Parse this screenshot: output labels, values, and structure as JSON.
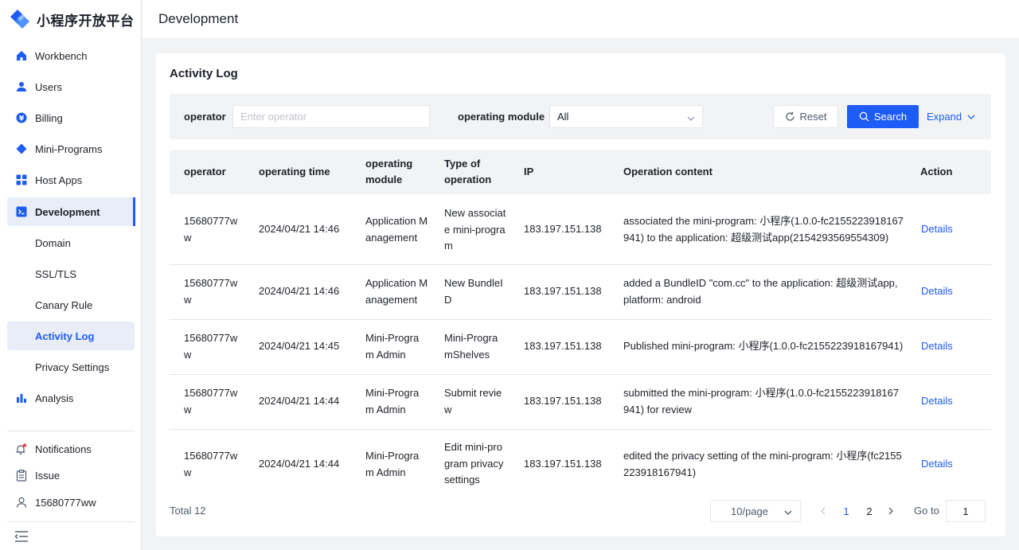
{
  "app": {
    "name": "小程序开放平台"
  },
  "sidebar": {
    "items": [
      {
        "label": "Workbench",
        "icon": "home-icon"
      },
      {
        "label": "Users",
        "icon": "user-icon"
      },
      {
        "label": "Billing",
        "icon": "billing-icon"
      },
      {
        "label": "Mini-Programs",
        "icon": "diamond-icon"
      },
      {
        "label": "Host Apps",
        "icon": "grid-icon"
      },
      {
        "label": "Development",
        "icon": "terminal-icon",
        "active": true
      }
    ],
    "sub_items": [
      {
        "label": "Domain"
      },
      {
        "label": "SSL/TLS"
      },
      {
        "label": "Canary Rule"
      },
      {
        "label": "Activity Log",
        "active": true
      },
      {
        "label": "Privacy Settings"
      }
    ],
    "analysis": {
      "label": "Analysis",
      "icon": "bar-chart-icon"
    },
    "bottom": [
      {
        "label": "Notifications",
        "icon": "bell-icon"
      },
      {
        "label": "Issue",
        "icon": "clipboard-icon"
      },
      {
        "label": "15680777ww",
        "icon": "person-icon"
      }
    ]
  },
  "header": {
    "title": "Development"
  },
  "card": {
    "title": "Activity Log"
  },
  "filter": {
    "operator_label": "operator",
    "operator_placeholder": "Enter operator",
    "operator_value": "",
    "module_label": "operating module",
    "module_value": "All",
    "reset_label": "Reset",
    "search_label": "Search",
    "expand_label": "Expand"
  },
  "table": {
    "columns": [
      "operator",
      "operating time",
      "operating module",
      "Type of operation",
      "IP",
      "Operation content",
      "Action"
    ],
    "rows": [
      {
        "operator": "15680777ww",
        "time": "2024/04/21 14:46",
        "module": "Application Management",
        "type": "New associate mini-program",
        "ip": "183.197.151.138",
        "content": "associated the mini-program: 小程序(1.0.0-fc2155223918167941) to the application: 超级测试app(2154293569554309)",
        "action": "Details"
      },
      {
        "operator": "15680777ww",
        "time": "2024/04/21 14:46",
        "module": "Application Management",
        "type": "New BundleID",
        "ip": "183.197.151.138",
        "content": "added a BundleID \"com.cc\" to the application: 超级测试app, platform: android",
        "action": "Details"
      },
      {
        "operator": "15680777ww",
        "time": "2024/04/21 14:45",
        "module": "Mini-Program Admin",
        "type": "Mini-ProgramShelves",
        "ip": "183.197.151.138",
        "content": "Published mini-program: 小程序(1.0.0-fc2155223918167941)",
        "action": "Details"
      },
      {
        "operator": "15680777ww",
        "time": "2024/04/21 14:44",
        "module": "Mini-Program Admin",
        "type": "Submit review",
        "ip": "183.197.151.138",
        "content": "submitted the mini-program: 小程序(1.0.0-fc2155223918167941) for review",
        "action": "Details"
      },
      {
        "operator": "15680777ww",
        "time": "2024/04/21 14:44",
        "module": "Mini-Program Admin",
        "type": "Edit mini-program privacy settings",
        "ip": "183.197.151.138",
        "content": "edited the privacy setting of the mini-program: 小程序(fc2155223918167941)",
        "action": "Details"
      }
    ]
  },
  "pagination": {
    "total": "Total 12",
    "page_size": "10/page",
    "pages": [
      "1",
      "2"
    ],
    "current": "1",
    "goto_label": "Go to",
    "goto_value": "1"
  },
  "colors": {
    "accent": "#1d5cf5",
    "active_bg": "#e8edf7",
    "page_bg": "#f2f3f5"
  }
}
